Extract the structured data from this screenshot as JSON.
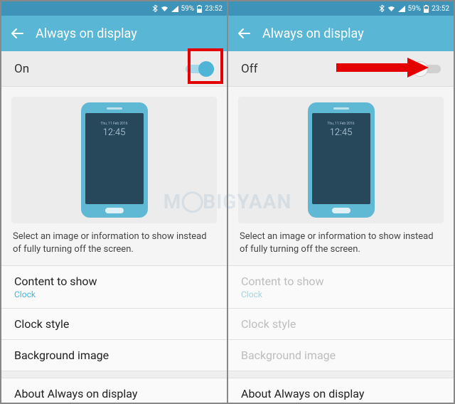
{
  "statusbar": {
    "battery_pct": "59%",
    "time": "23:52"
  },
  "header": {
    "title": "Always on display"
  },
  "left": {
    "toggle_label": "On",
    "toggle_state": "on"
  },
  "right": {
    "toggle_label": "Off",
    "toggle_state": "off"
  },
  "preview": {
    "phone_date": "Thu, 11 Feb 2016",
    "phone_time": "12:45",
    "phone_sub": "",
    "description": "Select an image or information to show instead of fully turning off the screen."
  },
  "items": {
    "content_to_show": {
      "title": "Content to show",
      "sub": "Clock"
    },
    "clock_style": {
      "title": "Clock style"
    },
    "background_image": {
      "title": "Background image"
    },
    "about": {
      "title": "About Always on display"
    }
  },
  "watermark": "M  BIGYAAN"
}
